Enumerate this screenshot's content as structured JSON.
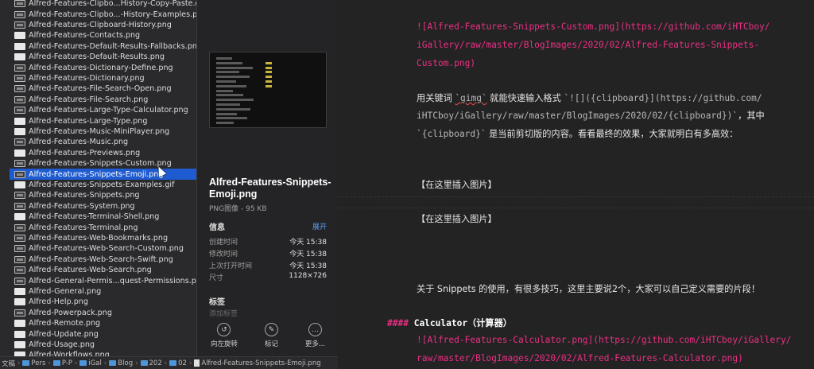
{
  "finder": {
    "files": [
      {
        "name": "Alfred-Features-Clipbo...History-Copy-Paste.gif",
        "icon": "gif-image-icon"
      },
      {
        "name": "Alfred-Features-Clipbo...-History-Examples.png",
        "icon": "png-image-icon"
      },
      {
        "name": "Alfred-Features-Clipboard-History.png",
        "icon": "png-image-icon"
      },
      {
        "name": "Alfred-Features-Contacts.png",
        "icon": "png-image-icon"
      },
      {
        "name": "Alfred-Features-Default-Results-Fallbacks.png",
        "icon": "png-image-icon"
      },
      {
        "name": "Alfred-Features-Default-Results.png",
        "icon": "png-image-icon"
      },
      {
        "name": "Alfred-Features-Dictionary-Define.png",
        "icon": "png-image-icon"
      },
      {
        "name": "Alfred-Features-Dictionary.png",
        "icon": "png-image-icon"
      },
      {
        "name": "Alfred-Features-File-Search-Open.png",
        "icon": "png-image-icon"
      },
      {
        "name": "Alfred-Features-File-Search.png",
        "icon": "png-image-icon"
      },
      {
        "name": "Alfred-Features-Large-Type-Calculator.png",
        "icon": "png-image-icon"
      },
      {
        "name": "Alfred-Features-Large-Type.png",
        "icon": "png-image-icon"
      },
      {
        "name": "Alfred-Features-Music-MiniPlayer.png",
        "icon": "png-image-icon"
      },
      {
        "name": "Alfred-Features-Music.png",
        "icon": "png-image-icon"
      },
      {
        "name": "Alfred-Features-Previews.png",
        "icon": "png-image-icon"
      },
      {
        "name": "Alfred-Features-Snippets-Custom.png",
        "icon": "png-image-icon"
      },
      {
        "name": "Alfred-Features-Snippets-Emoji.png",
        "icon": "png-image-icon",
        "selected": true
      },
      {
        "name": "Alfred-Features-Snippets-Examples.gif",
        "icon": "gif-image-icon"
      },
      {
        "name": "Alfred-Features-Snippets.png",
        "icon": "png-image-icon"
      },
      {
        "name": "Alfred-Features-System.png",
        "icon": "png-image-icon"
      },
      {
        "name": "Alfred-Features-Terminal-Shell.png",
        "icon": "png-image-icon"
      },
      {
        "name": "Alfred-Features-Terminal.png",
        "icon": "png-image-icon"
      },
      {
        "name": "Alfred-Features-Web-Bookmarks.png",
        "icon": "png-image-icon"
      },
      {
        "name": "Alfred-Features-Web-Search-Custom.png",
        "icon": "png-image-icon"
      },
      {
        "name": "Alfred-Features-Web-Search-Swift.png",
        "icon": "png-image-icon"
      },
      {
        "name": "Alfred-Features-Web-Search.png",
        "icon": "png-image-icon"
      },
      {
        "name": "Alfred-General-Permis...quest-Permissions.png",
        "icon": "png-image-icon"
      },
      {
        "name": "Alfred-General.png",
        "icon": "png-image-icon"
      },
      {
        "name": "Alfred-Help.png",
        "icon": "png-image-icon"
      },
      {
        "name": "Alfred-Powerpack.png",
        "icon": "png-image-icon"
      },
      {
        "name": "Alfred-Remote.png",
        "icon": "png-image-icon"
      },
      {
        "name": "Alfred-Update.png",
        "icon": "png-image-icon"
      },
      {
        "name": "Alfred-Usage.png",
        "icon": "png-image-icon"
      },
      {
        "name": "Alfred-Workflows.png",
        "icon": "png-image-icon"
      }
    ]
  },
  "preview": {
    "title": "Alfred-Features-Snippets-Emoji.png",
    "subtitle": "PNG图像 - 95 KB",
    "info_heading": "信息",
    "expand_label": "展开",
    "info": [
      {
        "label": "创建时间",
        "value": "今天 15:38"
      },
      {
        "label": "修改时间",
        "value": "今天 15:38"
      },
      {
        "label": "上次打开时间",
        "value": "今天 15:38"
      },
      {
        "label": "尺寸",
        "value": "1128×726"
      }
    ],
    "tags_heading": "标签",
    "tags_placeholder": "添加标签",
    "actions": [
      {
        "label": "向左旋转",
        "icon": "rotate-left-icon",
        "glyph": "↺"
      },
      {
        "label": "标记",
        "icon": "markup-icon",
        "glyph": "✎"
      },
      {
        "label": "更多...",
        "icon": "more-icon",
        "glyph": "…"
      }
    ]
  },
  "path_bar": {
    "crumbs": [
      "文稿",
      "Pers",
      "P-P",
      "iGal",
      "Blog",
      "202",
      "02"
    ],
    "current_file": "Alfred-Features-Snippets-Emoji.png"
  },
  "editor": {
    "link1": "![Alfred-Features-Snippets-Custom.png](https://github.com/iHTCboy/",
    "link2": "iGallery/raw/master/BlogImages/2020/02/Alfred-Features-Snippets-",
    "link3": "Custom.png)",
    "p1_a": "用关键词 ",
    "p1_code_keyword": "`gimg`",
    "p1_b": " 就能快速输入格式 ",
    "p1_code_format": "`![]({clipboard}](https://github.com/",
    "p2_code": "iHTCboy/iGallery/raw/master/BlogImages/2020/02/{clipboard})`",
    "p2_b": "，其中",
    "p3_code": "`{clipboard}`",
    "p3_b": " 是当前剪切版的内容。看看最终的效果，大家就明白有多高效：",
    "insert1": "【在这里插入图片】",
    "insert2": "【在这里插入图片】",
    "p4": "关于 Snippets 的使用，有很多技巧，这里主要说2个，大家可以自己定义需要的片段！",
    "heading_mark": "####",
    "heading_text": "Calculator（计算器）",
    "link4": "![Alfred-Features-Calculator.png](https://github.com/iHTCboy/iGallery/",
    "link5": "raw/master/BlogImages/2020/02/Alfred-Features-Calculator.png)"
  },
  "colors": {
    "selection": "#1f5bd0",
    "link_pink": "#ec2f85",
    "editor_bg": "#232323",
    "finder_bg": "#2a2a2c"
  }
}
